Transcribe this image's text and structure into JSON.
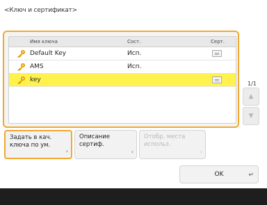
{
  "title": "<Ключ и сертификат>",
  "list": {
    "columns": {
      "name": "Имя ключа",
      "status": "Сост.",
      "cert": "Серт."
    },
    "rows": [
      {
        "name": "Default Key",
        "status": "Исп.",
        "has_cert": true,
        "selected": false
      },
      {
        "name": "AMS",
        "status": "Исп.",
        "has_cert": false,
        "selected": false
      },
      {
        "name": "key",
        "status": "",
        "has_cert": true,
        "selected": true
      }
    ]
  },
  "pager": {
    "label": "1/1",
    "up": "▲",
    "down": "▼"
  },
  "buttons": {
    "set_default": {
      "line1": "Задать в кач.",
      "line2": "ключа по ум."
    },
    "cert_details": {
      "line1": "Описание",
      "line2": "сертиф."
    },
    "show_locations": {
      "line1": "Отобр. места",
      "line2": "использ."
    },
    "chevron": "›"
  },
  "ok": {
    "label": "OK",
    "return_symbol": "↵"
  },
  "colors": {
    "accent": "#f0a830",
    "selected_row": "#fff24d",
    "bottom_bar": "#1e1e1e"
  }
}
